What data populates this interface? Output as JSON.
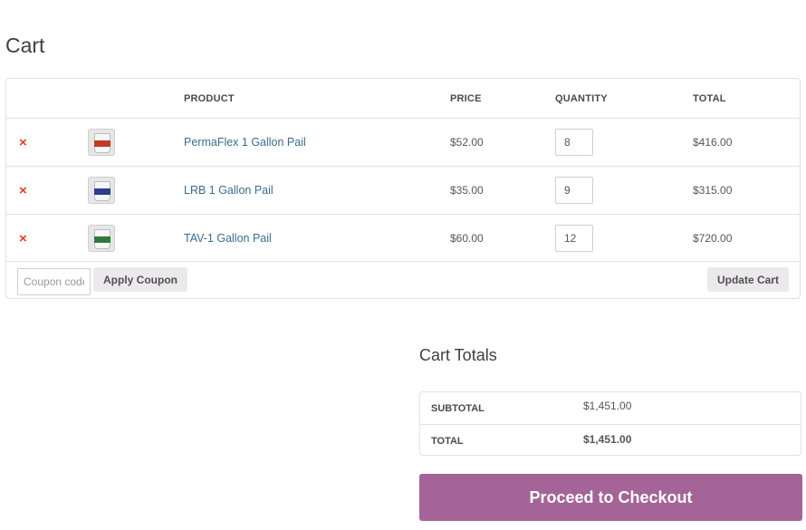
{
  "page": {
    "title": "Cart"
  },
  "cart": {
    "headers": {
      "product": "PRODUCT",
      "price": "PRICE",
      "quantity": "QUANTITY",
      "total": "TOTAL"
    },
    "remove_symbol": "×",
    "items": [
      {
        "name": "PermaFlex 1 Gallon Pail",
        "price": "$52.00",
        "quantity": "8",
        "total": "$416.00",
        "thumb_band_color": "#c23a22"
      },
      {
        "name": "LRB 1 Gallon Pail",
        "price": "$35.00",
        "quantity": "9",
        "total": "$315.00",
        "thumb_band_color": "#2a3f8f"
      },
      {
        "name": "TAV-1 Gallon Pail",
        "price": "$60.00",
        "quantity": "12",
        "total": "$720.00",
        "thumb_band_color": "#2f7a3a"
      }
    ],
    "coupon_placeholder": "Coupon code",
    "apply_coupon_label": "Apply Coupon",
    "update_cart_label": "Update Cart"
  },
  "totals": {
    "title": "Cart Totals",
    "subtotal_label": "SUBTOTAL",
    "subtotal_value": "$1,451.00",
    "total_label": "TOTAL",
    "total_value": "$1,451.00"
  },
  "checkout": {
    "label": "Proceed to Checkout",
    "color": "#a46497"
  },
  "colors": {
    "remove": "#e2401c",
    "link": "#3d6c8c",
    "button_bg": "#ebe9eb"
  },
  "icons": {
    "remove": "remove-x-icon",
    "thumbnail": "product-pail-image"
  }
}
